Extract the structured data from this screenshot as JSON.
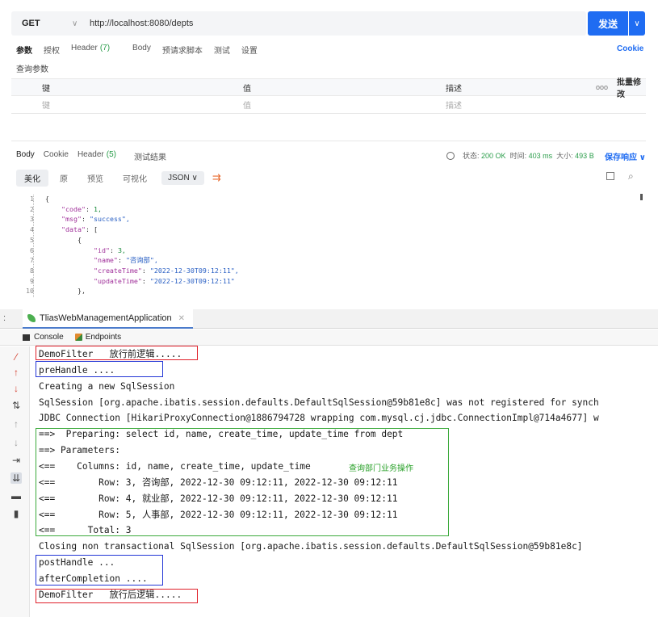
{
  "request": {
    "method": "GET",
    "url": "http://localhost:8080/depts",
    "send_label": "发送",
    "tabs": [
      "参数",
      "授权",
      "Header",
      "(7)",
      "Body",
      "预请求脚本",
      "测试",
      "设置"
    ],
    "cookie_label": "Cookie",
    "params_title": "查询参数",
    "params_table": {
      "headers": [
        "键",
        "值",
        "描述",
        "ooo",
        "批量修改"
      ],
      "placeholder": [
        "键",
        "值",
        "描述"
      ]
    }
  },
  "response": {
    "tabs": [
      "Body",
      "Cookie",
      "Header",
      "(5)",
      "测试结果"
    ],
    "status_label": "状态:",
    "status_value": "200 OK",
    "time_label": "时间:",
    "time_value": "403 ms",
    "size_label": "大小:",
    "size_value": "493 B",
    "save_label": "保存响应",
    "view_tabs": [
      "美化",
      "原",
      "预览",
      "可视化"
    ],
    "format": "JSON",
    "code_lines": [
      {
        "n": "1",
        "t": "{"
      },
      {
        "n": "2",
        "t": "    \"code\": 1,"
      },
      {
        "n": "3",
        "t": "    \"msg\": \"success\","
      },
      {
        "n": "4",
        "t": "    \"data\": ["
      },
      {
        "n": "5",
        "t": "        {"
      },
      {
        "n": "6",
        "t": "            \"id\": 3,"
      },
      {
        "n": "7",
        "t": "            \"name\": \"咨询部\","
      },
      {
        "n": "8",
        "t": "            \"createTime\": \"2022-12-30T09:12:11\","
      },
      {
        "n": "9",
        "t": "            \"updateTime\": \"2022-12-30T09:12:11\""
      },
      {
        "n": "10",
        "t": "        },"
      }
    ]
  },
  "ide": {
    "colon": ":",
    "run_tab": "TliasWebManagementApplication",
    "subtabs": [
      "Console",
      "Endpoints"
    ],
    "annotation": "查询部门业务操作",
    "lines": [
      "DemoFilter   放行前逻辑.....",
      "preHandle ....",
      "Creating a new SqlSession",
      "SqlSession [org.apache.ibatis.session.defaults.DefaultSqlSession@59b81e8c] was not registered for synch",
      "JDBC Connection [HikariProxyConnection@1886794728 wrapping com.mysql.cj.jdbc.ConnectionImpl@714a4677] w",
      "==>  Preparing: select id, name, create_time, update_time from dept",
      "==> Parameters: ",
      "<==    Columns: id, name, create_time, update_time",
      "<==        Row: 3, 咨询部, 2022-12-30 09:12:11, 2022-12-30 09:12:11",
      "<==        Row: 4, 就业部, 2022-12-30 09:12:11, 2022-12-30 09:12:11",
      "<==        Row: 5, 人事部, 2022-12-30 09:12:11, 2022-12-30 09:12:11",
      "<==      Total: 3",
      "Closing non transactional SqlSession [org.apache.ibatis.session.defaults.DefaultSqlSession@59b81e8c]",
      "postHandle ...",
      "afterCompletion ....",
      "DemoFilter   放行后逻辑....."
    ]
  }
}
